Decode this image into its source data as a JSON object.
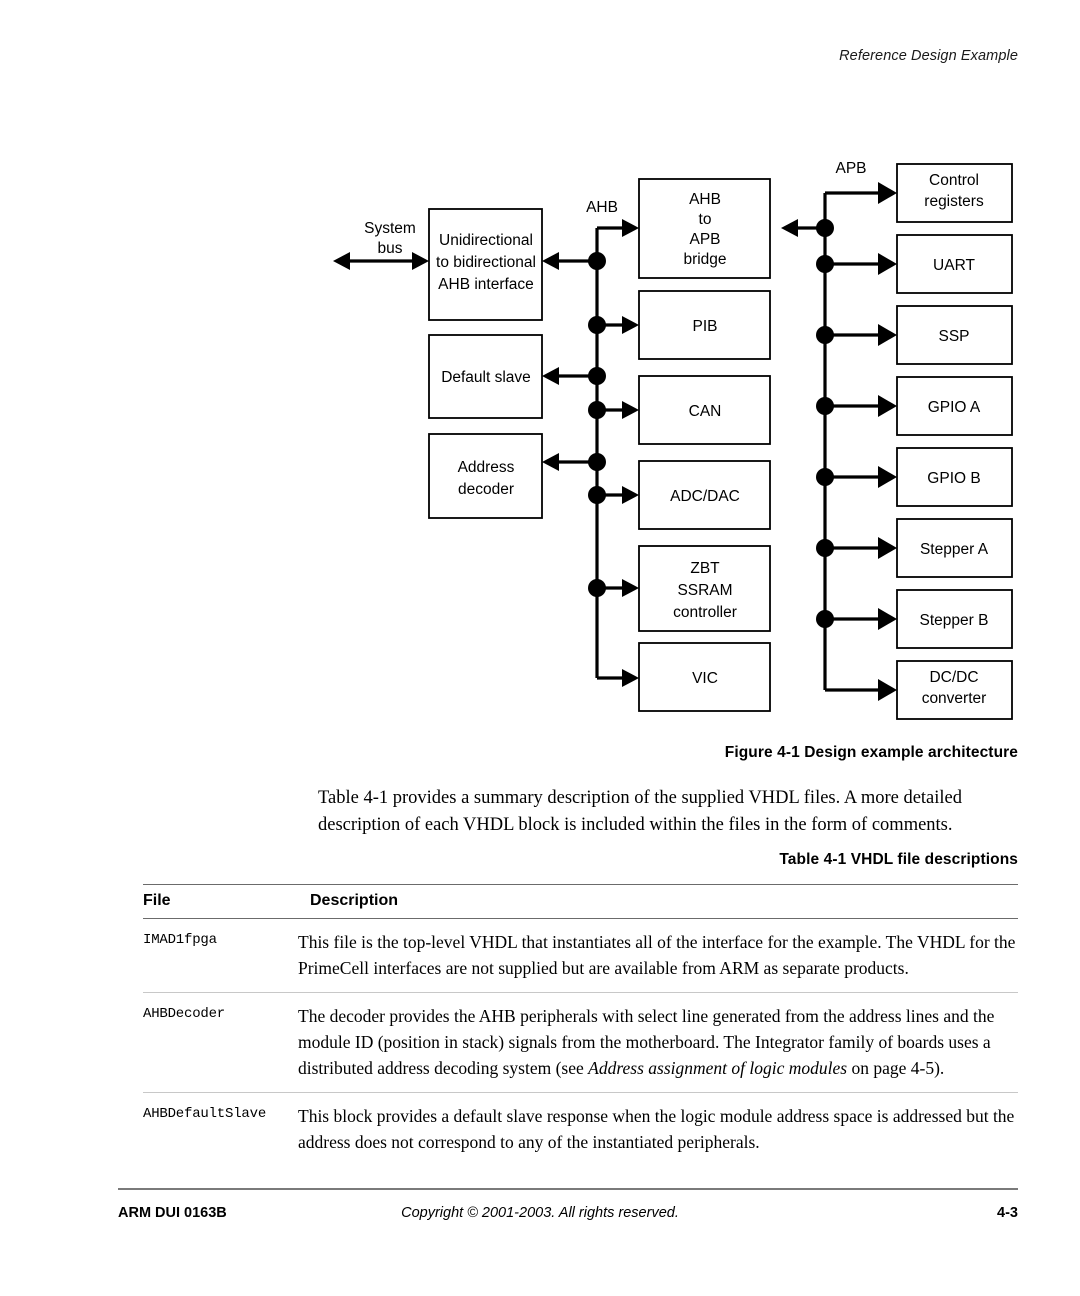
{
  "header": {
    "running_title": "Reference Design Example"
  },
  "figure": {
    "caption": "Figure 4-1 Design example architecture",
    "bus_labels": {
      "system": "System",
      "system2": "bus",
      "ahb": "AHB",
      "apb": "APB"
    },
    "left_blocks": [
      {
        "id": "ahb-interface",
        "lines": [
          "Unidirectional",
          "to bidirectional",
          "AHB interface"
        ]
      },
      {
        "id": "default-slave",
        "lines": [
          "Default slave"
        ]
      },
      {
        "id": "address-decoder",
        "lines": [
          "Address",
          "decoder"
        ]
      }
    ],
    "ahb_blocks": [
      {
        "id": "ahb-to-apb-bridge",
        "lines": [
          "AHB",
          "to",
          "APB",
          "bridge"
        ]
      },
      {
        "id": "pib",
        "lines": [
          "PIB"
        ]
      },
      {
        "id": "can",
        "lines": [
          "CAN"
        ]
      },
      {
        "id": "adc-dac",
        "lines": [
          "ADC/DAC"
        ]
      },
      {
        "id": "zbt-ssram-controller",
        "lines": [
          "ZBT",
          "SSRAM",
          "controller"
        ]
      },
      {
        "id": "vic",
        "lines": [
          "VIC"
        ]
      }
    ],
    "apb_blocks": [
      {
        "id": "control-registers",
        "lines": [
          "Control",
          "registers"
        ]
      },
      {
        "id": "uart",
        "lines": [
          "UART"
        ]
      },
      {
        "id": "ssp",
        "lines": [
          "SSP"
        ]
      },
      {
        "id": "gpio-a",
        "lines": [
          "GPIO A"
        ]
      },
      {
        "id": "gpio-b",
        "lines": [
          "GPIO B"
        ]
      },
      {
        "id": "stepper-a",
        "lines": [
          "Stepper A"
        ]
      },
      {
        "id": "stepper-b",
        "lines": [
          "Stepper B"
        ]
      },
      {
        "id": "dc-dc-converter",
        "lines": [
          "DC/DC",
          "converter"
        ]
      }
    ]
  },
  "body": {
    "paragraph": "Table 4-1 provides a summary description of the supplied VHDL files. A more detailed description of each VHDL block is included within the files in the form of comments."
  },
  "table": {
    "caption": "Table 4-1 VHDL file descriptions",
    "headers": {
      "file": "File",
      "description": "Description"
    },
    "rows": [
      {
        "file": "IMAD1fpga",
        "desc_pre": "This file is the top-level VHDL that instantiates all of the interface for the example. The VHDL for the PrimeCell interfaces are not supplied but are available from ARM as separate products.",
        "desc_italic": "",
        "desc_post": ""
      },
      {
        "file": "AHBDecoder",
        "desc_pre": "The decoder provides the AHB peripherals with select line generated from the address lines and the module ID (position in stack) signals from the motherboard. The Integrator family of boards uses a distributed address decoding system (see ",
        "desc_italic": "Address assignment of logic modules",
        "desc_post": " on page 4-5)."
      },
      {
        "file": "AHBDefaultSlave",
        "desc_pre": "This block provides a default slave response when the logic module address space is addressed but the address does not correspond to any of the instantiated peripherals.",
        "desc_italic": "",
        "desc_post": ""
      }
    ]
  },
  "footer": {
    "doc_id": "ARM DUI 0163B",
    "copyright": "Copyright © 2001-2003. All rights reserved.",
    "page": "4-3"
  }
}
